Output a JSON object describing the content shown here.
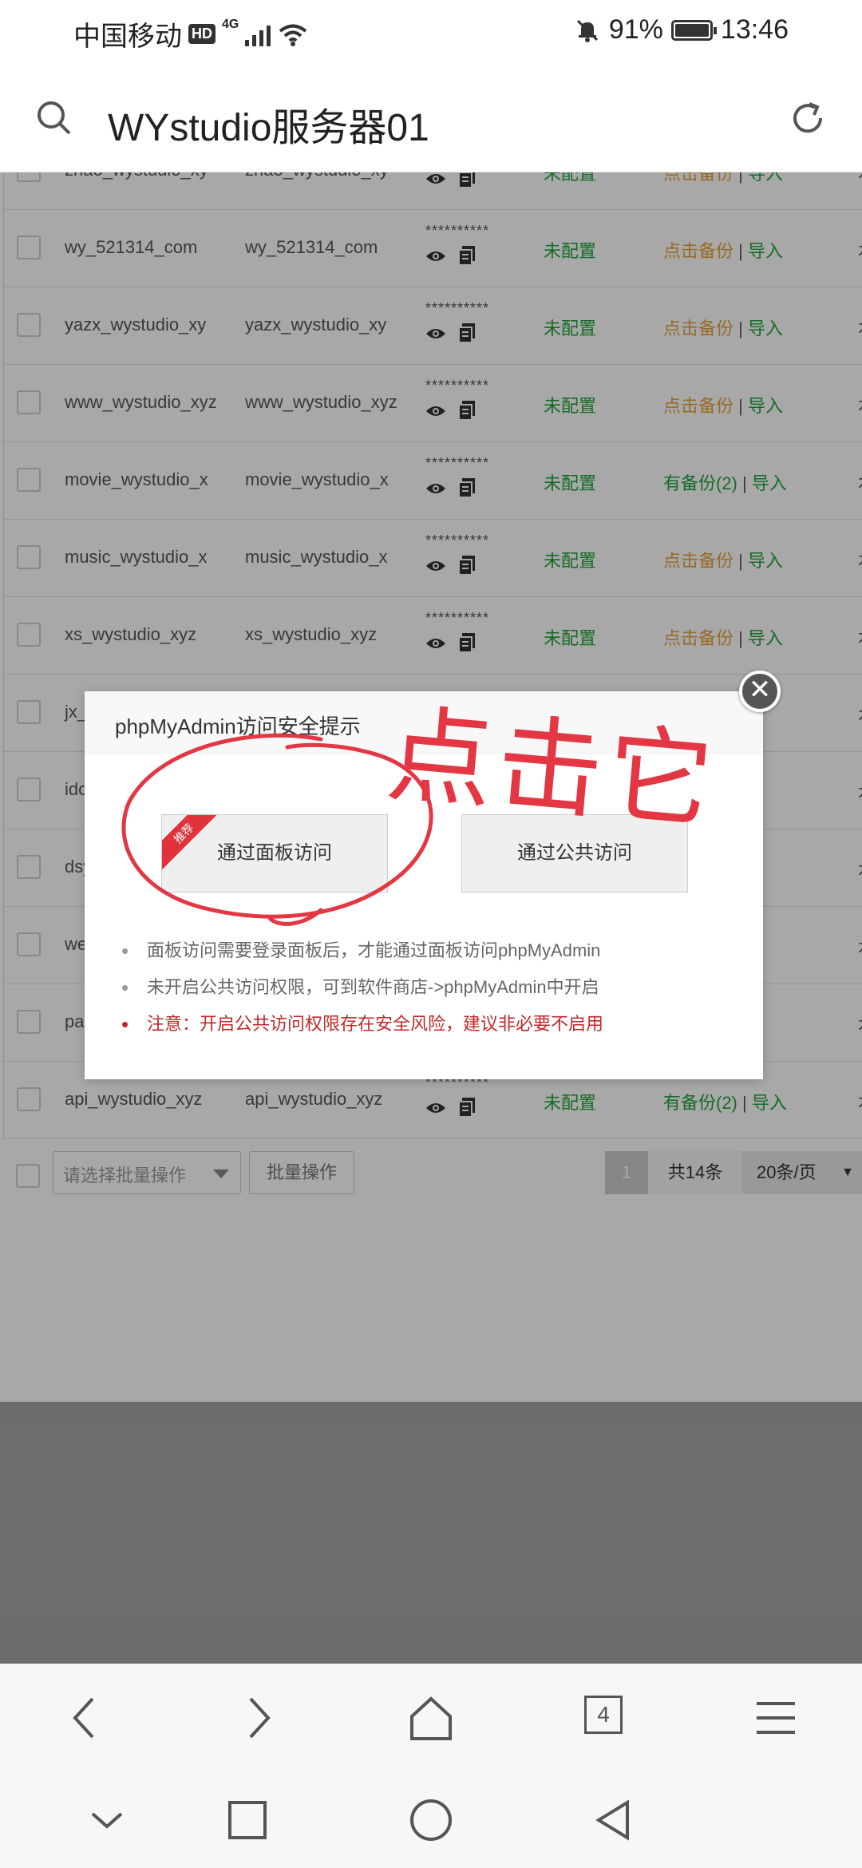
{
  "status_bar": {
    "carrier": "中国移动",
    "hd": "HD",
    "network": "4G",
    "battery_pct": "91%",
    "time": "13:46"
  },
  "app_bar": {
    "title": "WYstudio服务器01"
  },
  "table": {
    "rows": [
      {
        "name": "zhao_wystudio_xy",
        "user": "zhao_wystudio_xy",
        "password": "**********",
        "status": "未配置",
        "backup": "点击备份",
        "backup_kind": "none",
        "import": "导入"
      },
      {
        "name": "wy_521314_com",
        "user": "wy_521314_com",
        "password": "**********",
        "status": "未配置",
        "backup": "点击备份",
        "backup_kind": "none",
        "import": "导入"
      },
      {
        "name": "yazx_wystudio_xy",
        "user": "yazx_wystudio_xy",
        "password": "**********",
        "status": "未配置",
        "backup": "点击备份",
        "backup_kind": "none",
        "import": "导入"
      },
      {
        "name": "www_wystudio_xyz",
        "user": "www_wystudio_xyz",
        "password": "**********",
        "status": "未配置",
        "backup": "点击备份",
        "backup_kind": "none",
        "import": "导入"
      },
      {
        "name": "movie_wystudio_x",
        "user": "movie_wystudio_x",
        "password": "**********",
        "status": "未配置",
        "backup": "有备份(2)",
        "backup_kind": "has",
        "import": "导入"
      },
      {
        "name": "music_wystudio_x",
        "user": "music_wystudio_x",
        "password": "**********",
        "status": "未配置",
        "backup": "点击备份",
        "backup_kind": "none",
        "import": "导入"
      },
      {
        "name": "xs_wystudio_xyz",
        "user": "xs_wystudio_xyz",
        "password": "**********",
        "status": "未配置",
        "backup": "点击备份",
        "backup_kind": "none",
        "import": "导入"
      },
      {
        "name": "jx_",
        "user": "",
        "password": "",
        "status": "",
        "backup": "",
        "backup_kind": "none",
        "import": ""
      },
      {
        "name": "ido",
        "user": "",
        "password": "",
        "status": "",
        "backup": "",
        "backup_kind": "none",
        "import": "入"
      },
      {
        "name": "dsy",
        "user": "",
        "password": "",
        "status": "",
        "backup": "",
        "backup_kind": "none",
        "import": "入"
      },
      {
        "name": "we",
        "user": "",
        "password": "",
        "status": "",
        "backup": "",
        "backup_kind": "none",
        "import": "入"
      },
      {
        "name": "pa",
        "user": "",
        "password": "",
        "status": "",
        "backup": "",
        "backup_kind": "none",
        "import": "入"
      },
      {
        "name": "api_wystudio_xyz",
        "user": "api_wystudio_xyz",
        "password": "**********",
        "status": "未配置",
        "backup": "有备份(2)",
        "backup_kind": "has",
        "import": "导入"
      }
    ],
    "separator": "|",
    "trailing": "本"
  },
  "batch": {
    "select_placeholder": "请选择批量操作",
    "button_label": "批量操作"
  },
  "pager": {
    "current_page": "1",
    "total": "共14条",
    "per_page": "20条/页"
  },
  "dialog": {
    "title": "phpMyAdmin访问安全提示",
    "ribbon": "推荐",
    "panel_button": "通过面板访问",
    "public_button": "通过公共访问",
    "tips": [
      "面板访问需要登录面板后，才能通过面板访问phpMyAdmin",
      "未开启公共访问权限，可到软件商店->phpMyAdmin中开启"
    ],
    "warning": "注意：开启公共访问权限存在安全风险，建议非必要不启用",
    "close_symbol": "✕"
  },
  "annotation": {
    "text": "点击它",
    "color": "#e33744"
  },
  "browser_nav": {
    "tab_count": "4"
  },
  "colors": {
    "accent_green": "#20a53a",
    "warn_orange": "#e6a23c",
    "danger_red": "#c12828"
  }
}
